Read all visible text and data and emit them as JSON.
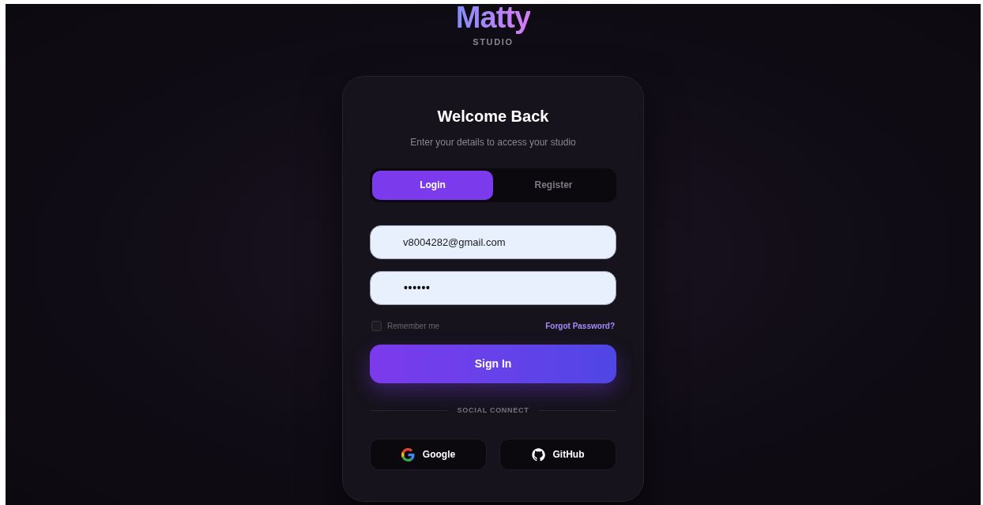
{
  "logo": {
    "name": "Matty",
    "tagline": "STUDIO"
  },
  "card": {
    "title": "Welcome Back",
    "subtitle": "Enter your details to access your studio"
  },
  "tabs": [
    {
      "label": "Login",
      "selected": true
    },
    {
      "label": "Register",
      "selected": false
    }
  ],
  "fields": [
    {
      "kind": "email",
      "value": "v8004282@gmail.com"
    },
    {
      "kind": "password",
      "value": "••••••"
    }
  ],
  "remember": {
    "label": "Remember me",
    "checked": false
  },
  "forgot_link": "Forgot Password?",
  "submit": "Sign In",
  "divider": "SOCIAL CONNECT",
  "social": [
    {
      "kind": "google",
      "label": "Google"
    },
    {
      "kind": "github",
      "label": "GitHub"
    }
  ]
}
